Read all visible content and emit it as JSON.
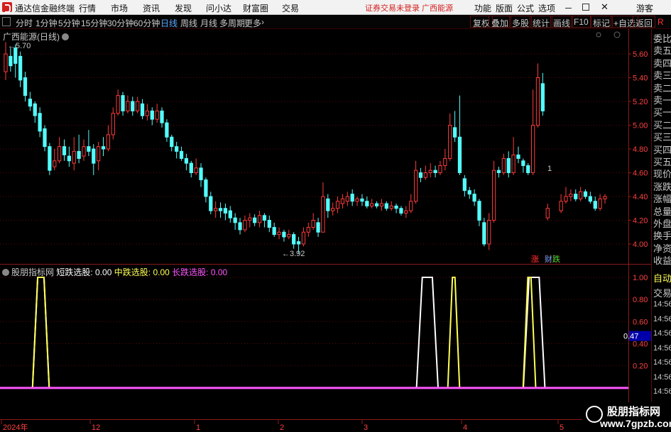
{
  "app": {
    "title": "通达信金融终端",
    "menus": [
      "行情",
      "市场",
      "资讯",
      "发现",
      "问小达",
      "财富圈",
      "交易"
    ],
    "warning": "证券交易未登录  广西能源",
    "right_menus": [
      "功能",
      "版面",
      "公式",
      "选项"
    ],
    "guest": "游客",
    "close_glyph": "✕"
  },
  "toolbar": {
    "periods": [
      "分时",
      "1分钟",
      "5分钟",
      "15分钟",
      "30分钟",
      "60分钟",
      "日线",
      "周线",
      "月线",
      "多周期",
      "更多"
    ],
    "selected": "日线",
    "more_glyph": "›",
    "buttons": [
      "复权",
      "叠加",
      "多股",
      "统计",
      "画线",
      "F10",
      "标记",
      "+自选",
      "返回"
    ]
  },
  "main_chart": {
    "title": "广西能源(日线)",
    "high_label": "5.70",
    "low_label": "3.92",
    "arrow_glyph": "←",
    "marker_label": "1",
    "badges": [
      {
        "text": "涨",
        "color": "#ff3333"
      },
      {
        "text": "财",
        "color": "#56a8ff"
      },
      {
        "text": "跌",
        "color": "#33dd33"
      }
    ],
    "y_ticks": [
      "5.60",
      "5.40",
      "5.20",
      "5.00",
      "4.80",
      "4.60",
      "4.40",
      "4.20",
      "4.00"
    ],
    "up_color": "#ff3b3b",
    "down_color": "#54fcfc"
  },
  "sub_chart": {
    "title": "股朋指标网",
    "legend": [
      {
        "label": "短跌选股",
        "value": "0.00",
        "color": "#ffffff"
      },
      {
        "label": "中跌选股",
        "value": "0.00",
        "color": "#ffff55"
      },
      {
        "label": "长跌选股",
        "value": "0.00",
        "color": "#ff55ff"
      }
    ],
    "y_ticks": [
      "1.00",
      "0.80",
      "0.60",
      "0.47",
      "0.40",
      "0.20"
    ],
    "current_value": "0.47"
  },
  "time_axis": [
    "2024年",
    "12",
    "1",
    "2",
    "3",
    "4",
    "5"
  ],
  "side_panel": {
    "labels": [
      "委比",
      "卖五",
      "卖四",
      "卖三",
      "卖二",
      "卖一",
      "买一",
      "买二",
      "买三",
      "买四",
      "买五",
      "现价",
      "涨跌",
      "涨幅",
      "总量",
      "外盘",
      "换手",
      "净资",
      "收益"
    ],
    "sub_labels": [
      "自动",
      "交易",
      "14:56",
      "14:56",
      "14:56",
      "14:56",
      "14:56",
      "14:56",
      "14:56",
      "14:56"
    ],
    "header_glyph": "R"
  },
  "watermark": {
    "line1": "股朋指标网",
    "line2": "www.7gpzb.com"
  },
  "chart_data": {
    "type": "candlestick",
    "title": "广西能源(日线)",
    "ylim": [
      3.85,
      5.72
    ],
    "y_ticks": [
      4.0,
      4.2,
      4.4,
      4.6,
      4.8,
      5.0,
      5.2,
      5.4,
      5.6
    ],
    "bars": [
      [
        5.45,
        5.6,
        5.7,
        5.38
      ],
      [
        5.58,
        5.5,
        5.65,
        5.45
      ],
      [
        5.65,
        5.52,
        5.68,
        5.4
      ],
      [
        5.58,
        5.38,
        5.62,
        5.32
      ],
      [
        5.4,
        5.25,
        5.45,
        5.2
      ],
      [
        5.22,
        5.16,
        5.28,
        5.12
      ],
      [
        5.18,
        5.08,
        5.2,
        5.02
      ],
      [
        5.1,
        4.95,
        5.15,
        4.9
      ],
      [
        4.97,
        4.82,
        5.0,
        4.78
      ],
      [
        4.82,
        4.62,
        4.85,
        4.58
      ],
      [
        4.65,
        4.7,
        4.8,
        4.62
      ],
      [
        4.7,
        4.82,
        4.9,
        4.68
      ],
      [
        4.82,
        4.75,
        4.88,
        4.7
      ],
      [
        4.74,
        4.7,
        4.82,
        4.65
      ],
      [
        4.68,
        4.78,
        4.9,
        4.62
      ],
      [
        4.78,
        4.72,
        4.92,
        4.68
      ],
      [
        4.74,
        4.82,
        4.88,
        4.7
      ],
      [
        4.82,
        4.78,
        4.96,
        4.74
      ],
      [
        4.8,
        4.68,
        4.84,
        4.58
      ],
      [
        4.7,
        4.82,
        4.86,
        4.62
      ],
      [
        4.82,
        4.8,
        4.9,
        4.74
      ],
      [
        4.8,
        4.92,
        5.0,
        4.78
      ],
      [
        4.92,
        5.1,
        5.15,
        4.88
      ],
      [
        5.1,
        5.25,
        5.3,
        5.08
      ],
      [
        5.25,
        5.12,
        5.28,
        5.08
      ],
      [
        5.12,
        5.2,
        5.25,
        5.1
      ],
      [
        5.2,
        5.12,
        5.24,
        5.08
      ],
      [
        5.12,
        5.2,
        5.24,
        5.1
      ],
      [
        5.18,
        5.08,
        5.22,
        5.05
      ],
      [
        5.08,
        5.12,
        5.18,
        5.04
      ],
      [
        5.12,
        5.05,
        5.15,
        5.0
      ],
      [
        5.05,
        5.12,
        5.18,
        5.02
      ],
      [
        5.12,
        5.02,
        5.15,
        4.98
      ],
      [
        5.02,
        4.9,
        5.05,
        4.86
      ],
      [
        4.9,
        4.82,
        4.92,
        4.78
      ],
      [
        4.82,
        4.78,
        4.86,
        4.72
      ],
      [
        4.78,
        4.72,
        4.82,
        4.7
      ],
      [
        4.72,
        4.68,
        4.76,
        4.62
      ],
      [
        4.68,
        4.6,
        4.7,
        4.56
      ],
      [
        4.6,
        4.64,
        4.72,
        4.58
      ],
      [
        4.64,
        4.54,
        4.68,
        4.48
      ],
      [
        4.54,
        4.4,
        4.56,
        4.35
      ],
      [
        4.4,
        4.28,
        4.44,
        4.25
      ],
      [
        4.28,
        4.3,
        4.36,
        4.22
      ],
      [
        4.3,
        4.28,
        4.35,
        4.22
      ],
      [
        4.3,
        4.26,
        4.34,
        4.2
      ],
      [
        4.28,
        4.22,
        4.32,
        4.18
      ],
      [
        4.22,
        4.18,
        4.26,
        4.12
      ],
      [
        4.18,
        4.12,
        4.22,
        4.08
      ],
      [
        4.12,
        4.2,
        4.24,
        4.1
      ],
      [
        4.2,
        4.22,
        4.26,
        4.14
      ],
      [
        4.22,
        4.18,
        4.25,
        4.15
      ],
      [
        4.18,
        4.24,
        4.28,
        4.14
      ],
      [
        4.24,
        4.2,
        4.26,
        4.14
      ],
      [
        4.2,
        4.14,
        4.24,
        4.1
      ],
      [
        4.14,
        4.08,
        4.18,
        4.06
      ],
      [
        4.08,
        4.1,
        4.14,
        4.04
      ],
      [
        4.1,
        4.06,
        4.12,
        4.02
      ],
      [
        4.06,
        4.08,
        4.12,
        4.04
      ],
      [
        4.08,
        4.0,
        4.1,
        3.96
      ],
      [
        4.02,
        4.0,
        4.06,
        3.92
      ],
      [
        4.0,
        4.1,
        4.14,
        3.98
      ],
      [
        4.1,
        4.14,
        4.18,
        4.06
      ],
      [
        4.14,
        4.2,
        4.26,
        4.12
      ],
      [
        4.18,
        4.1,
        4.22,
        4.06
      ],
      [
        4.1,
        4.4,
        4.52,
        4.1
      ],
      [
        4.38,
        4.28,
        4.42,
        4.22
      ],
      [
        4.28,
        4.3,
        4.35,
        4.24
      ],
      [
        4.3,
        4.36,
        4.4,
        4.26
      ],
      [
        4.34,
        4.38,
        4.42,
        4.3
      ],
      [
        4.36,
        4.4,
        4.44,
        4.32
      ],
      [
        4.42,
        4.36,
        4.46,
        4.32
      ],
      [
        4.36,
        4.38,
        4.4,
        4.32
      ],
      [
        4.38,
        4.36,
        4.42,
        4.32
      ],
      [
        4.36,
        4.32,
        4.4,
        4.3
      ],
      [
        4.32,
        4.34,
        4.38,
        4.3
      ],
      [
        4.34,
        4.32,
        4.36,
        4.3
      ],
      [
        4.32,
        4.34,
        4.38,
        4.28
      ],
      [
        4.34,
        4.3,
        4.36,
        4.28
      ],
      [
        4.3,
        4.32,
        4.36,
        4.28
      ],
      [
        4.32,
        4.3,
        4.34,
        4.26
      ],
      [
        4.3,
        4.26,
        4.32,
        4.24
      ],
      [
        4.26,
        4.28,
        4.32,
        4.22
      ],
      [
        4.28,
        4.36,
        4.42,
        4.26
      ],
      [
        4.36,
        4.62,
        4.7,
        4.34
      ],
      [
        4.6,
        4.56,
        4.64,
        4.52
      ],
      [
        4.56,
        4.6,
        4.66,
        4.54
      ],
      [
        4.6,
        4.62,
        4.68,
        4.56
      ],
      [
        4.62,
        4.6,
        4.66,
        4.56
      ],
      [
        4.6,
        4.66,
        4.7,
        4.58
      ],
      [
        4.66,
        4.72,
        4.8,
        4.62
      ],
      [
        4.72,
        5.0,
        5.1,
        4.7
      ],
      [
        4.98,
        4.9,
        5.12,
        4.86
      ],
      [
        4.9,
        4.6,
        5.25,
        4.58
      ],
      [
        4.55,
        4.45,
        4.58,
        4.4
      ],
      [
        4.45,
        4.42,
        4.48,
        4.38
      ],
      [
        4.42,
        4.36,
        4.46,
        4.32
      ],
      [
        4.36,
        4.2,
        4.38,
        4.15
      ],
      [
        4.18,
        4.0,
        4.22,
        3.98
      ],
      [
        4.0,
        4.2,
        4.26,
        3.95
      ],
      [
        4.2,
        4.62,
        4.7,
        4.18
      ],
      [
        4.62,
        4.6,
        4.65,
        4.56
      ],
      [
        4.6,
        4.72,
        4.76,
        4.58
      ],
      [
        4.72,
        4.6,
        4.78,
        4.56
      ],
      [
        4.6,
        4.75,
        4.9,
        4.58
      ],
      [
        4.75,
        4.72,
        4.82,
        4.68
      ],
      [
        4.7,
        4.66,
        4.72,
        4.6
      ],
      [
        4.66,
        4.6,
        4.68,
        4.58
      ],
      [
        4.6,
        5.0,
        5.3,
        4.58
      ],
      [
        5.0,
        5.4,
        5.52,
        4.98
      ],
      [
        5.35,
        5.12,
        5.44,
        5.08
      ],
      [
        4.22,
        4.3,
        4.34,
        4.2
      ],
      [
        4.28,
        4.36,
        4.42,
        4.26
      ],
      [
        4.36,
        4.4,
        4.48,
        4.34
      ],
      [
        4.4,
        4.42,
        4.46,
        4.36
      ],
      [
        4.42,
        4.38,
        4.46,
        4.36
      ],
      [
        4.38,
        4.44,
        4.48,
        4.36
      ],
      [
        4.44,
        4.4,
        4.46,
        4.38
      ],
      [
        4.4,
        4.36,
        4.44,
        4.34
      ],
      [
        4.36,
        4.3,
        4.4,
        4.28
      ],
      [
        4.3,
        4.38,
        4.42,
        4.28
      ],
      [
        4.38,
        4.4,
        4.42,
        4.34
      ]
    ],
    "gap_after_index": 111,
    "signals": {
      "short": {
        "color": "#ffffff",
        "events": [
          [
            0.06,
            0.07
          ],
          [
            0.672,
            0.688
          ],
          [
            0.842,
            0.858
          ]
        ]
      },
      "mid": {
        "color": "#ffff55",
        "events": [
          [
            0.06,
            0.07
          ],
          [
            0.72,
            0.724
          ],
          [
            0.84,
            0.845
          ]
        ]
      },
      "long": {
        "color": "#ff55ff",
        "value": 0.0
      }
    },
    "sub_ylim": [
      0,
      1.05
    ]
  }
}
